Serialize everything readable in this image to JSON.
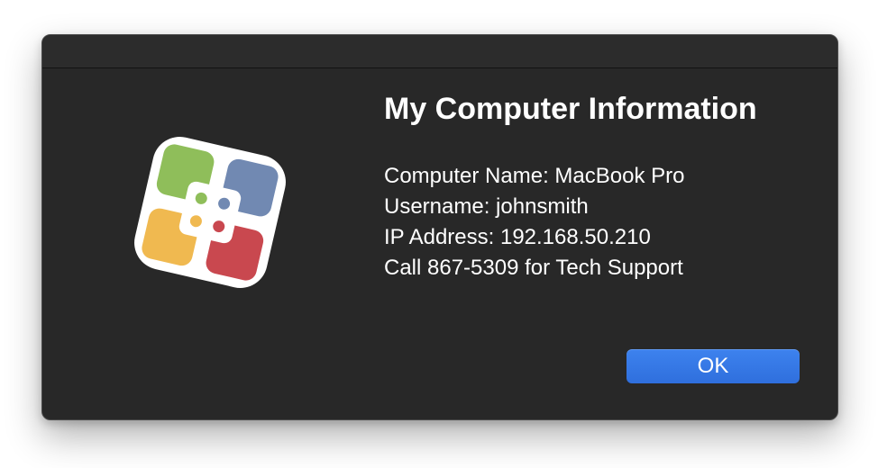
{
  "dialog": {
    "title": "My Computer Information",
    "info_lines": [
      "Computer Name: MacBook Pro",
      "Username: johnsmith",
      "IP Address: 192.168.50.210",
      "Call 867-5309 for Tech Support"
    ],
    "ok_label": "OK",
    "icon": "app-grid-logo-icon"
  },
  "colors": {
    "window_background": "#282828",
    "accent": "#3478f6",
    "logo_green": "#8fbe5a",
    "logo_blue": "#7189b2",
    "logo_yellow": "#f0b950",
    "logo_red": "#c9484f"
  }
}
